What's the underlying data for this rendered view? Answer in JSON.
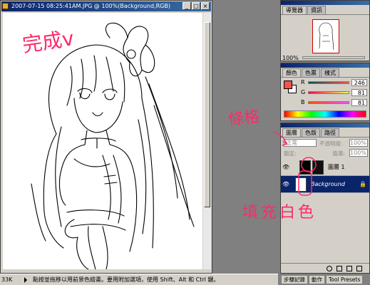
{
  "document": {
    "title": "2007-07-15 08:25:41AM.JPG @ 100%(Background,RGB)",
    "minimize": "_",
    "maximize": "□",
    "close": "×"
  },
  "status": {
    "zoom": "33K",
    "message": "點按並拖移以用前景色繪畫。要用附加選項，使用 Shift、Alt 和 Ctrl 鍵。"
  },
  "navigator": {
    "tabs": [
      "導覽器",
      "資訊"
    ],
    "zoom": "100%"
  },
  "color": {
    "tabs": [
      "顏色",
      "色票",
      "樣式"
    ],
    "channels": [
      {
        "label": "R",
        "value": "246"
      },
      {
        "label": "G",
        "value": "81"
      },
      {
        "label": "B",
        "value": "81"
      }
    ],
    "foreground": "#f65151",
    "background": "#ffffff"
  },
  "layers": {
    "tabs": [
      "圖層",
      "色版",
      "路徑"
    ],
    "mode": "正常",
    "opacity_label": "不透明度:",
    "opacity": "100%",
    "lock_label": "鎖定:",
    "fill_label": "填滿:",
    "fill": "100%",
    "items": [
      {
        "name": "圖層 1",
        "selected": false
      },
      {
        "name": "Background",
        "selected": true
      }
    ]
  },
  "annotations": {
    "done": "完成v",
    "link": "條格",
    "fill_white": "填充白色"
  },
  "bottom_tabs": [
    "步驟記錄",
    "動作",
    "Tool Presets"
  ]
}
